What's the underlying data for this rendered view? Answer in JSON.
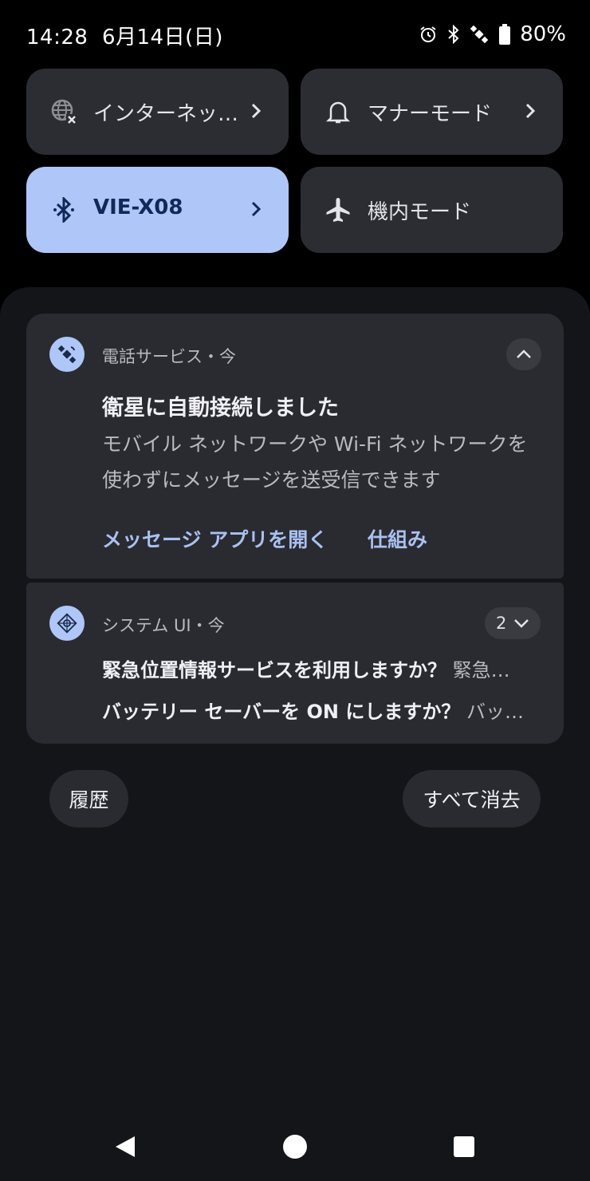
{
  "status_bar": {
    "time": "14:28",
    "date": "6月14日(日)",
    "battery": "80%",
    "icons": [
      "alarm-icon",
      "bluetooth-icon",
      "satellite-icon",
      "battery-icon"
    ]
  },
  "quick_tiles": [
    {
      "label": "インターネッ…",
      "icon": "globe-off-icon",
      "active": false,
      "has_chevron": true
    },
    {
      "label": "マナーモード",
      "icon": "bell-icon",
      "active": false,
      "has_chevron": true
    },
    {
      "label": "VIE-X08",
      "icon": "bluetooth-icon",
      "active": true,
      "has_chevron": true
    },
    {
      "label": "機内モード",
      "icon": "airplane-icon",
      "active": false,
      "has_chevron": false
    }
  ],
  "notifications": {
    "satellite": {
      "app_name": "電話サービス・今",
      "title": "衛星に自動接続しました",
      "body_line1": "モバイル ネットワークや Wi-Fi ネットワークを",
      "body_line2": "使わずにメッセージを送受信できます",
      "action_primary": "メッセージ アプリを開く",
      "action_secondary": "仕組み"
    },
    "system_ui": {
      "app_name": "システム UI・今",
      "count": "2",
      "items": [
        {
          "title": "緊急位置情報サービスを利用しますか？",
          "preview": "緊急…"
        },
        {
          "title": "バッテリー セーバーを ON にしますか？",
          "preview": "バッ…"
        }
      ]
    }
  },
  "buttons": {
    "history": "履歴",
    "clear_all": "すべて消去"
  },
  "colors": {
    "accent": "#aec6f8",
    "action_text": "#a9c1f2",
    "card_bg": "#2a2b30",
    "shade_bg": "#141519"
  }
}
